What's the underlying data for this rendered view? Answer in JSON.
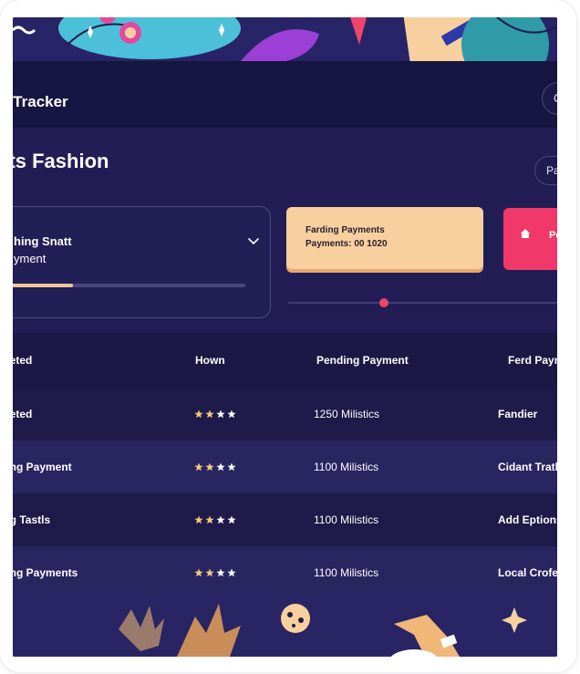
{
  "header": {
    "title": "s Tracker",
    "action_label": "C"
  },
  "section": {
    "title": "nts Fashion",
    "pill_label": "Pa",
    "dropdown": {
      "line1": "hing Snatt",
      "line2": "yment",
      "progress": 0.3
    },
    "payment_card": {
      "line1": "Farding Payments",
      "line2": "Payments: 00 1020"
    },
    "slider": {
      "value": 0.35
    },
    "pink_button": {
      "label": "Pe"
    }
  },
  "table": {
    "headers": [
      "pleted",
      "Hown",
      "Pending Payment",
      "Ferd Paym"
    ],
    "rows": [
      {
        "status": "pleted",
        "stars": 4,
        "filled": 2,
        "amount": "1250 Milistics",
        "ref": "Fandier"
      },
      {
        "status": "ding Payment",
        "stars": 4,
        "filled": 2,
        "amount": "1100 Milistics",
        "ref": "Cidant Tratle"
      },
      {
        "status": "ing Tastls",
        "stars": 4,
        "filled": 2,
        "amount": "1100 Milistics",
        "ref": "Add Eptions"
      },
      {
        "status": "ding Payments",
        "stars": 4,
        "filled": 2,
        "amount": "1100 Milistics",
        "ref": "Local Crofer"
      }
    ]
  },
  "colors": {
    "background": "#1f1b4b",
    "accent_peach": "#f8cf9e",
    "accent_pink": "#f0396a",
    "star_filled": "#f4c978",
    "star_empty": "#ffffff"
  }
}
